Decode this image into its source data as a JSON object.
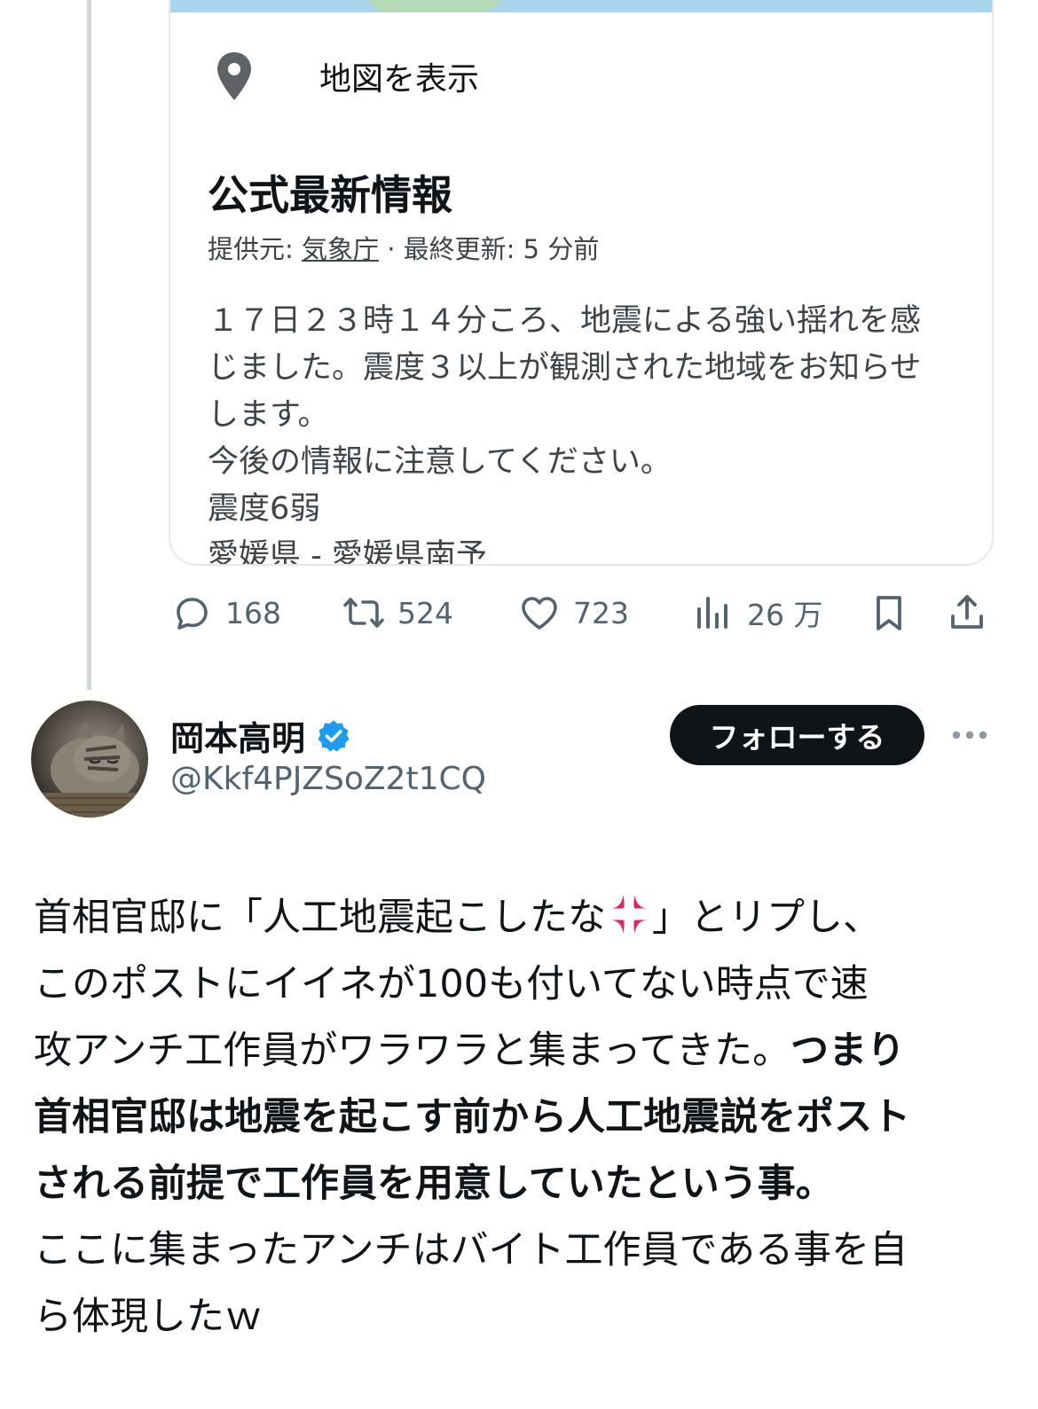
{
  "quoted_post": {
    "map_link_label": "地図を表示",
    "info_title": "公式最新情報",
    "meta_prefix": "提供元: ",
    "meta_source": "気象庁",
    "meta_suffix": " · 最終更新: 5 分前",
    "body_lines": [
      "１７日２３時１４分ころ、地震による強い揺れを感",
      "じました。震度３以上が観測された地域をお知らせ",
      "します。",
      "今後の情報に注意してください。",
      "震度6弱",
      "愛媛県 - 愛媛県南予"
    ]
  },
  "actions": {
    "replies": "168",
    "reposts": "524",
    "likes": "723",
    "views": "26 万"
  },
  "post": {
    "user_name": "岡本高明",
    "handle": "@Kkf4PJZSoZ2t1CQ",
    "follow_label": "フォローする",
    "line1_a": "首相官邸に「人工地震起こしたな",
    "line1_b": "」とリプし、",
    "line2": "このポストにイイネが100も付いてない時点で速",
    "line3_normal": "攻アンチ工作員がワラワラと集まってきた。",
    "line3_bold": "つまり",
    "line4_bold": "首相官邸は地震を起こす前から人工地震説をポスト",
    "line5_bold": "される前提で工作員を用意していたという事。",
    "line6": "ここに集まったアンチはバイト工作員である事を自",
    "line7": "ら体現したｗ"
  },
  "colors": {
    "follow_bg": "#0f1419",
    "verified": "#1d9bf0",
    "secondary_text": "#536471",
    "anger_emoji": "#e0245e"
  }
}
